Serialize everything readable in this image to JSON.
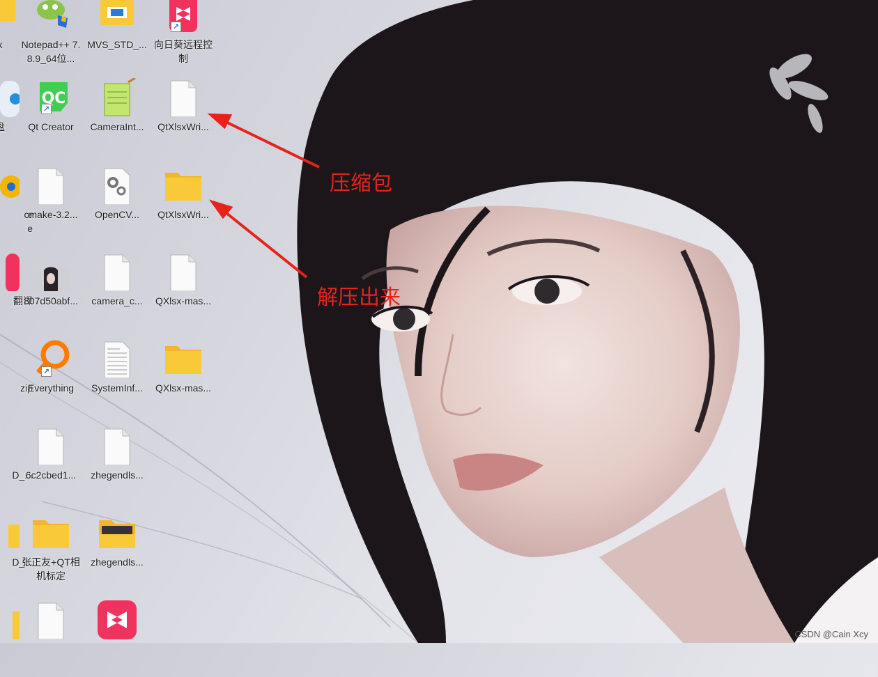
{
  "desktop": {
    "icons": [
      {
        "id": "edge-k",
        "label": "k"
      },
      {
        "id": "notepad",
        "label": "Notepad++ 7.8.9_64位..."
      },
      {
        "id": "mvs",
        "label": "MVS_STD_..."
      },
      {
        "id": "sunlogin",
        "label": "向日葵远程控制"
      },
      {
        "id": "edge-pan",
        "label": "盘"
      },
      {
        "id": "qtcreator",
        "label": "Qt Creator"
      },
      {
        "id": "camerainit",
        "label": "CameraInt..."
      },
      {
        "id": "qtxlsx-zip",
        "label": "QtXlsxWri..."
      },
      {
        "id": "edge-e",
        "label": "e\ne"
      },
      {
        "id": "cmake",
        "label": "cmake-3.2..."
      },
      {
        "id": "opencv",
        "label": "OpenCV..."
      },
      {
        "id": "qtxlsx-folder",
        "label": "QtXlsxWri..."
      },
      {
        "id": "edge-fanyi",
        "label": "翻译"
      },
      {
        "id": "img807",
        "label": "807d50abf..."
      },
      {
        "id": "camerac",
        "label": "camera_c..."
      },
      {
        "id": "qxlsx-file",
        "label": "QXlsx-mas..."
      },
      {
        "id": "edge-zip",
        "label": "zip"
      },
      {
        "id": "everything",
        "label": "Everything"
      },
      {
        "id": "sysinfo",
        "label": "SystemInf..."
      },
      {
        "id": "qxlsx-folder",
        "label": "QXlsx-mas..."
      },
      {
        "id": "edge-d1",
        "label": "D_..."
      },
      {
        "id": "file6c2",
        "label": "6c2cbed1..."
      },
      {
        "id": "zheng1",
        "label": "zhegendls..."
      },
      {
        "id": "edge-d2",
        "label": "D_..."
      },
      {
        "id": "zhangzy",
        "label": "张正友+QT相机标定"
      },
      {
        "id": "zheng2",
        "label": "zhegendls..."
      }
    ]
  },
  "annotations": {
    "zip_label": "压缩包",
    "extract_label": "解压出来"
  },
  "watermark": "CSDN @Cain Xcy",
  "colors": {
    "annotation": "#e8221a",
    "folder": "#f9c93a"
  }
}
